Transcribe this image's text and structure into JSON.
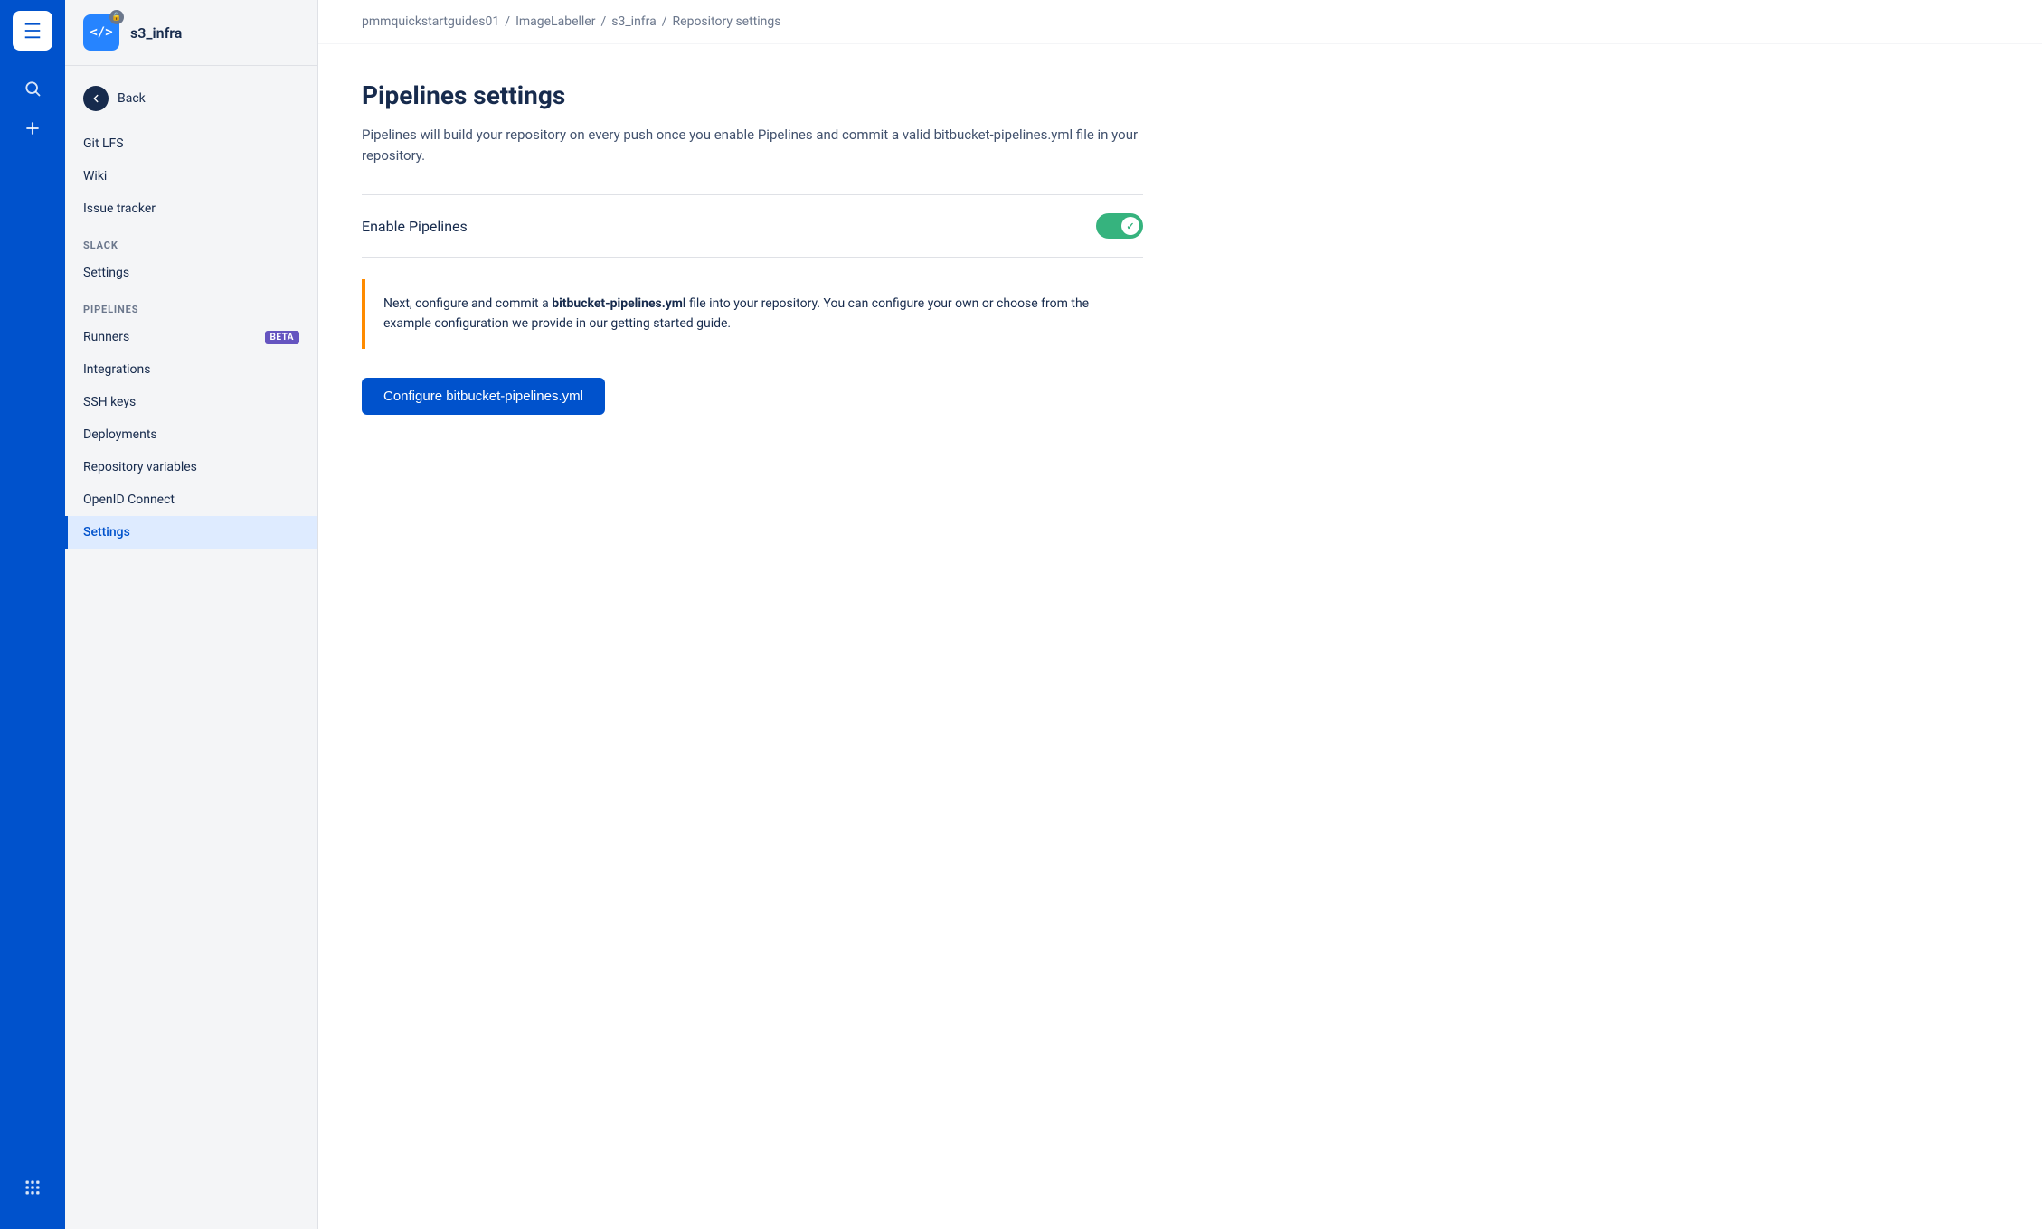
{
  "app": {
    "logo": "⊞",
    "search_icon": "🔍",
    "add_icon": "+"
  },
  "repo": {
    "name": "s3_infra",
    "icon_text": "</>",
    "lock": "🔒"
  },
  "breadcrumb": {
    "items": [
      {
        "label": "pmmquickstartguides01",
        "sep": "/"
      },
      {
        "label": "ImageLabeller",
        "sep": "/"
      },
      {
        "label": "s3_infra",
        "sep": "/"
      },
      {
        "label": "Repository settings",
        "sep": ""
      }
    ]
  },
  "sidebar": {
    "back_label": "Back",
    "nav_items_top": [
      {
        "label": "Git LFS",
        "active": false
      },
      {
        "label": "Wiki",
        "active": false
      },
      {
        "label": "Issue tracker",
        "active": false
      }
    ],
    "slack_section": "SLACK",
    "slack_items": [
      {
        "label": "Settings",
        "active": false
      }
    ],
    "pipelines_section": "PIPELINES",
    "pipelines_items": [
      {
        "label": "Runners",
        "badge": "BETA",
        "active": false
      },
      {
        "label": "Integrations",
        "active": false
      },
      {
        "label": "SSH keys",
        "active": false
      },
      {
        "label": "Deployments",
        "active": false
      },
      {
        "label": "Repository variables",
        "active": false
      },
      {
        "label": "OpenID Connect",
        "active": false
      },
      {
        "label": "Settings",
        "active": true
      }
    ]
  },
  "page": {
    "title": "Pipelines settings",
    "description": "Pipelines will build your repository on every push once you enable Pipelines and commit a valid bitbucket-pipelines.yml file in your repository.",
    "enable_label": "Enable Pipelines",
    "toggle_enabled": true,
    "info_text_before": "Next, configure and commit a ",
    "info_text_bold": "bitbucket-pipelines.yml",
    "info_text_after": " file into your repository. You can configure your own or choose from the example configuration we provide in our getting started guide.",
    "button_label": "Configure bitbucket-pipelines.yml"
  }
}
